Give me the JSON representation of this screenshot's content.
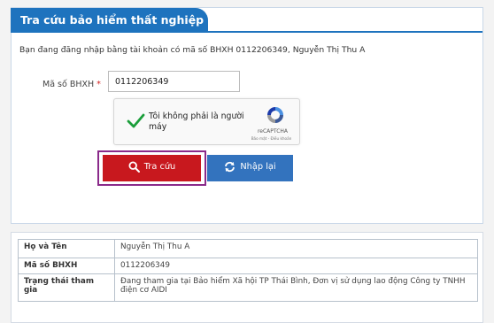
{
  "panel": {
    "tab_title": "Tra cứu bảo hiểm thất nghiệp"
  },
  "login": {
    "message": "Bạn đang đăng nhập bằng tài khoản có mã số BHXH 0112206349, Nguyễn Thị Thu A"
  },
  "form": {
    "field_label": "Mã số BHXH",
    "required_mark": "*",
    "field_value": "0112206349"
  },
  "captcha": {
    "prompt": "Tôi không phải là người máy",
    "brand": "reCAPTCHA",
    "links": "Bảo mật - Điều khoản",
    "check_icon": "checkmark-icon",
    "logo_icon": "recaptcha-logo-icon"
  },
  "buttons": {
    "search_label": "Tra cứu",
    "search_icon": "search-icon",
    "reset_label": "Nhập lại",
    "reset_icon": "refresh-icon",
    "search_color": "#c8181e",
    "reset_color": "#3373be",
    "highlight_color": "#8a2a8a"
  },
  "result": {
    "rows": [
      {
        "key": "Họ và Tên",
        "value": "Nguyễn Thị Thu A"
      },
      {
        "key": "Mã số BHXH",
        "value": "0112206349"
      },
      {
        "key": "Trạng thái tham gia",
        "value": "Đang tham gia tại Bảo hiểm Xã hội TP Thái Bình, Đơn vị sử dụng lao động Công ty TNHH điện cơ AIDI"
      }
    ]
  },
  "colors": {
    "tab_blue": "#1e73be",
    "required_red": "#d21f1f"
  }
}
